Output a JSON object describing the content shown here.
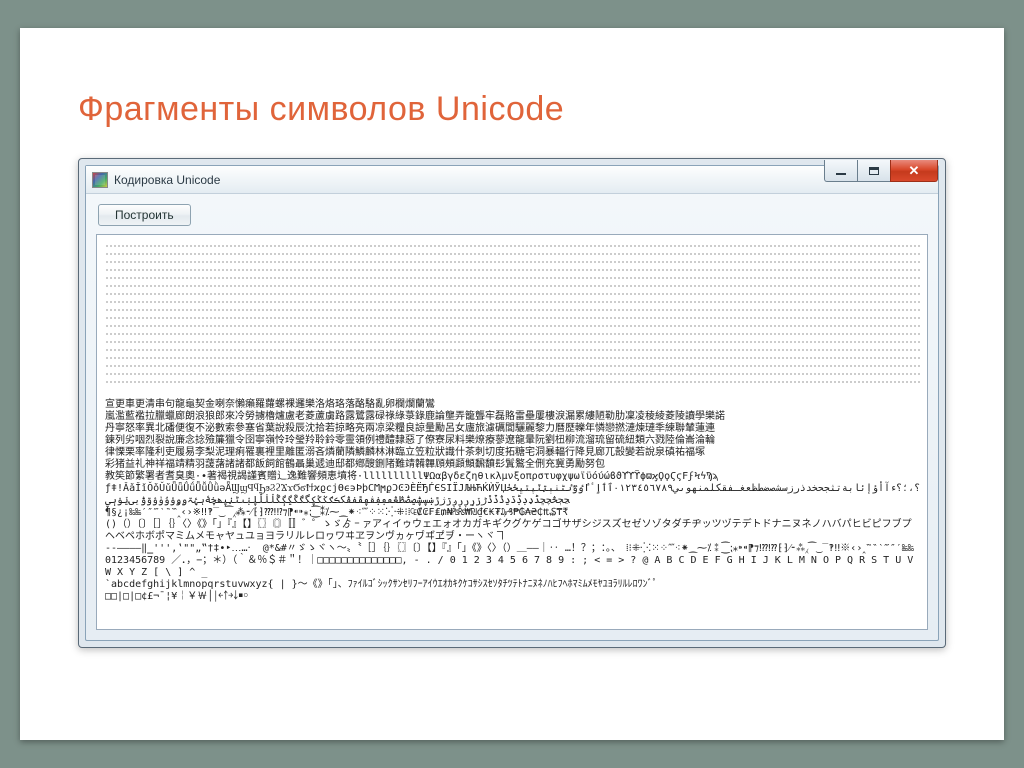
{
  "slide": {
    "title": "Фрагменты символов Unicode"
  },
  "window": {
    "title": "Кодировка Unicode",
    "controls": {
      "minimize": "minimize",
      "maximize": "maximize",
      "close": "close"
    }
  },
  "toolbar": {
    "build_label": "Построить"
  },
  "content": {
    "dot_rows": 18,
    "lines": [
      "　　　　　　　　　　　　　　　　　　　　　　　　　　　　　　　　　　　　　　　　　　　　　　　　　　　　　　　　　　　　　　　　　　　　　　　　　　　　　　　　　　　　　　　　　　　　　　　　　　　　　　　　　　　　　　宣更車更清串句龍龜契金喇奈懶癩羅蘿螺裸邏樂洛烙珞落酪駱亂卵欄爛蘭鸞",
      "嵐濫藍襤拉臘蠟廊朗浪狼郎來冷勞擄櫓爐盧老菱蘆虜路露鷺露碌祿綠菉錄鹿論壟弄籠聾牢磊賂雷壘屢樓淚漏累縷陋勒肋凜凌稜綾菱陵讀學樂諾",
      "丹寧怒率異北磻便復不泌數索參塞省葉說殺辰沈拾若掠略亮兩凉梁糧良諒量勵呂女廬旅濾礪閭驪麗黎力曆歷轢年憐戀撚漣煉璉秊練聯輦蓮連",
      "鍊列劣咽烈裂說廉念捻殮簾獵令囹寧嶺怜玲瑩羚聆鈴零靈領例禮醴隸惡了僚寮尿料樂燎療蓼遼龍暈阮劉杻柳流溜琉留硫紐類六戮陸倫崙淪輪",
      "律慄栗率隆利吏履易李梨泥理痢罹裏裡里離匿溺吝燐藺隣鱗麟林淋臨立笠粒狀識什茶刺切度拓糖宅洞暴輻行降見廊兀嗀變若說泉磌祐福塚",
      "彩猪益礼神祥福靖精羽蘐藷諸諸都飯飼館鶴聶巢遞迪邸都鄕醙鉶陼難靖韛韠頋頰頿顦飜馩髟鬒鸄全侀充冀勇勵努包",
      "教笶節繁署者耆臭奧·•著褐視謁謹賓贈辶逸難響頻恵墳将·llllllllllΨΩαβγδεζηθικλμνξοπρστυφχψωϊϋόύώϐϑϒϓϔϕϖϗϘϙϚϛϜϝϞϟϠϡ",
      "ƒǂǃǍǎǏǐǑǒǓǔǕǖǗǘǙǚǛǜǝǞϢϣϤϥϦϧϨϩϪϫϬϭϮϯϰϱϲϳϴϵ϶ϷϸϹϺϻϼϽϾϿЀЁЂЃЄЅІЇЈЉЊЋЌЍЎЏ؟،؛؟ءآأؤإئابةتثجحخدذرزسشصضطظعغـفقكلمنهوىي٠١٢٣٤٥٦٧٨٩ٱٲٳٴٵٶٷٸٹٺٻټٽپٿڀځڂڃڄڅچڇڈډڊڋڌڍڎڏڐڑڒړڔڕږڗژڙښڛڜڝڞڟڠڡڢڣڤڥڦڧڨکڪګڬڭڮگڰڱڲڳڴڵڶڷڸڹںڻڼڽھڿۀہۂۃۄۅۆۇۈۉۊۋیۍێۏېۑ",
      "¶§¿¡‰‱′″‴‵‶‷‸‹›※‼‽‾‿⁀⁁⁂⁃⁄⁅⁆⁇⁈⁉⁊⁋⁌⁍⁎⁏⁐⁑⁒⁓⁔⁕⁖⁗⁘⁙⁚⁛⁜⁝⁞₠₡₢₣₤₥₦₧₨₩₪₫€₭₮₯₰₱₲₳₴₵₶₷₸₹",
      "()（）〔〕［］｛｝〈〉《》「」『』【】〖〗〘〙〚〛゛゜ゝゞゟ゠ァアィイゥウェエォオカガキギクグケゲコゴサザシジスズセゼソゾタダチヂッツヅテデトドナニヌネノハバパヒビピフブプヘベペホボポマミムメモャヤュユョヨラリルレロヮワヰヱヲンヴヵヶヷヸヹヺ・ーヽヾヿ",
      "‐‑‒–—―‖‗'''‚‛\"\"„‟†‡•‣․‥…‧  ‪‫‬‭‮ ‰‱′″‴‵‶‷‸‹›※‼‽‾‿⁀⁁⁂⁃⁄⁅⁆⁇⁈⁉⁊⁋⁌⁍⁎⁏⁐⁑⁒⁓⁔⁕⁖⁗⁘⁙⁚⁛⁜⁝⁞　、。：；？！… ‥｜–—＿（）〈〉《》「」『』【】〔〕〖〗｛｝［］〝〟〜ヽヾゝゞ〃#&*@",
      "0123456789 ／．，−；＊）（｀＆％＄＃＂！｜□□□□□□□□□□□□□□, - . / 0 1 2 3 4 5 6 7 8 9 : ; < = > ? @ A B C D E F G H I J K L M N O P Q R S T U V W X Y Z [ \\ ] ^ _",
      "`abcdefghijklmnopqrstuvwxyz{ | }〜《》｢｣、ﾌｧｲﾙｺﾞｼｯｸｻﾝｾﾘﾌｰｱｲｳｴｵｶｷｸｹｺｻｼｽｾｿﾀﾁﾂﾃﾄﾅﾆﾇﾈﾉﾊﾋﾌﾍﾎﾏﾐﾑﾒﾓﾔﾕﾖﾗﾘﾙﾚﾛﾜﾝﾞﾟ",
      "□□|□|□¢£¬¯¦¥￤￥￦│￨￩￪￫￬￭￮"
    ]
  }
}
